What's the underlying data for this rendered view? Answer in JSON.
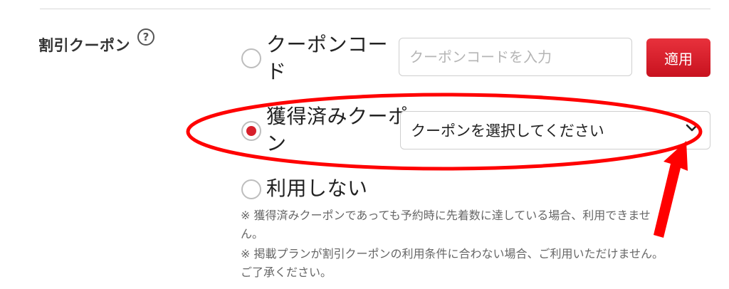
{
  "coupon_section": {
    "title": "割引クーポン",
    "help_icon_glyph": "?",
    "options": [
      {
        "label_line1": "クーポンコー",
        "label_line2": "ド",
        "selected": false
      },
      {
        "label_line1": "獲得済みクーポ",
        "label_line2": "ン",
        "selected": true
      },
      {
        "label_line1": "利用しない",
        "selected": false
      }
    ],
    "coupon_code_input": {
      "placeholder": "クーポンコードを入力",
      "value": ""
    },
    "apply_button_label": "適用",
    "coupon_select": {
      "selected_text": "クーポンを選択してください"
    },
    "notes": [
      {
        "line1": "※ 獲得済みクーポンであっても予約時に先着数に達している場合、利用できませ",
        "line2": "ん。"
      },
      {
        "line1": "※ 掲載プランが割引クーポンの利用条件に合わない場合、ご利用いただけません。",
        "line2": "ご了承ください。"
      }
    ]
  },
  "colors": {
    "accent_red": "#d7202b",
    "annotation_red": "#ff0000"
  },
  "annotation": {
    "shape": "ellipse-around-acquired-coupon-row",
    "arrow": "pointing-to-dropdown-chevron"
  }
}
